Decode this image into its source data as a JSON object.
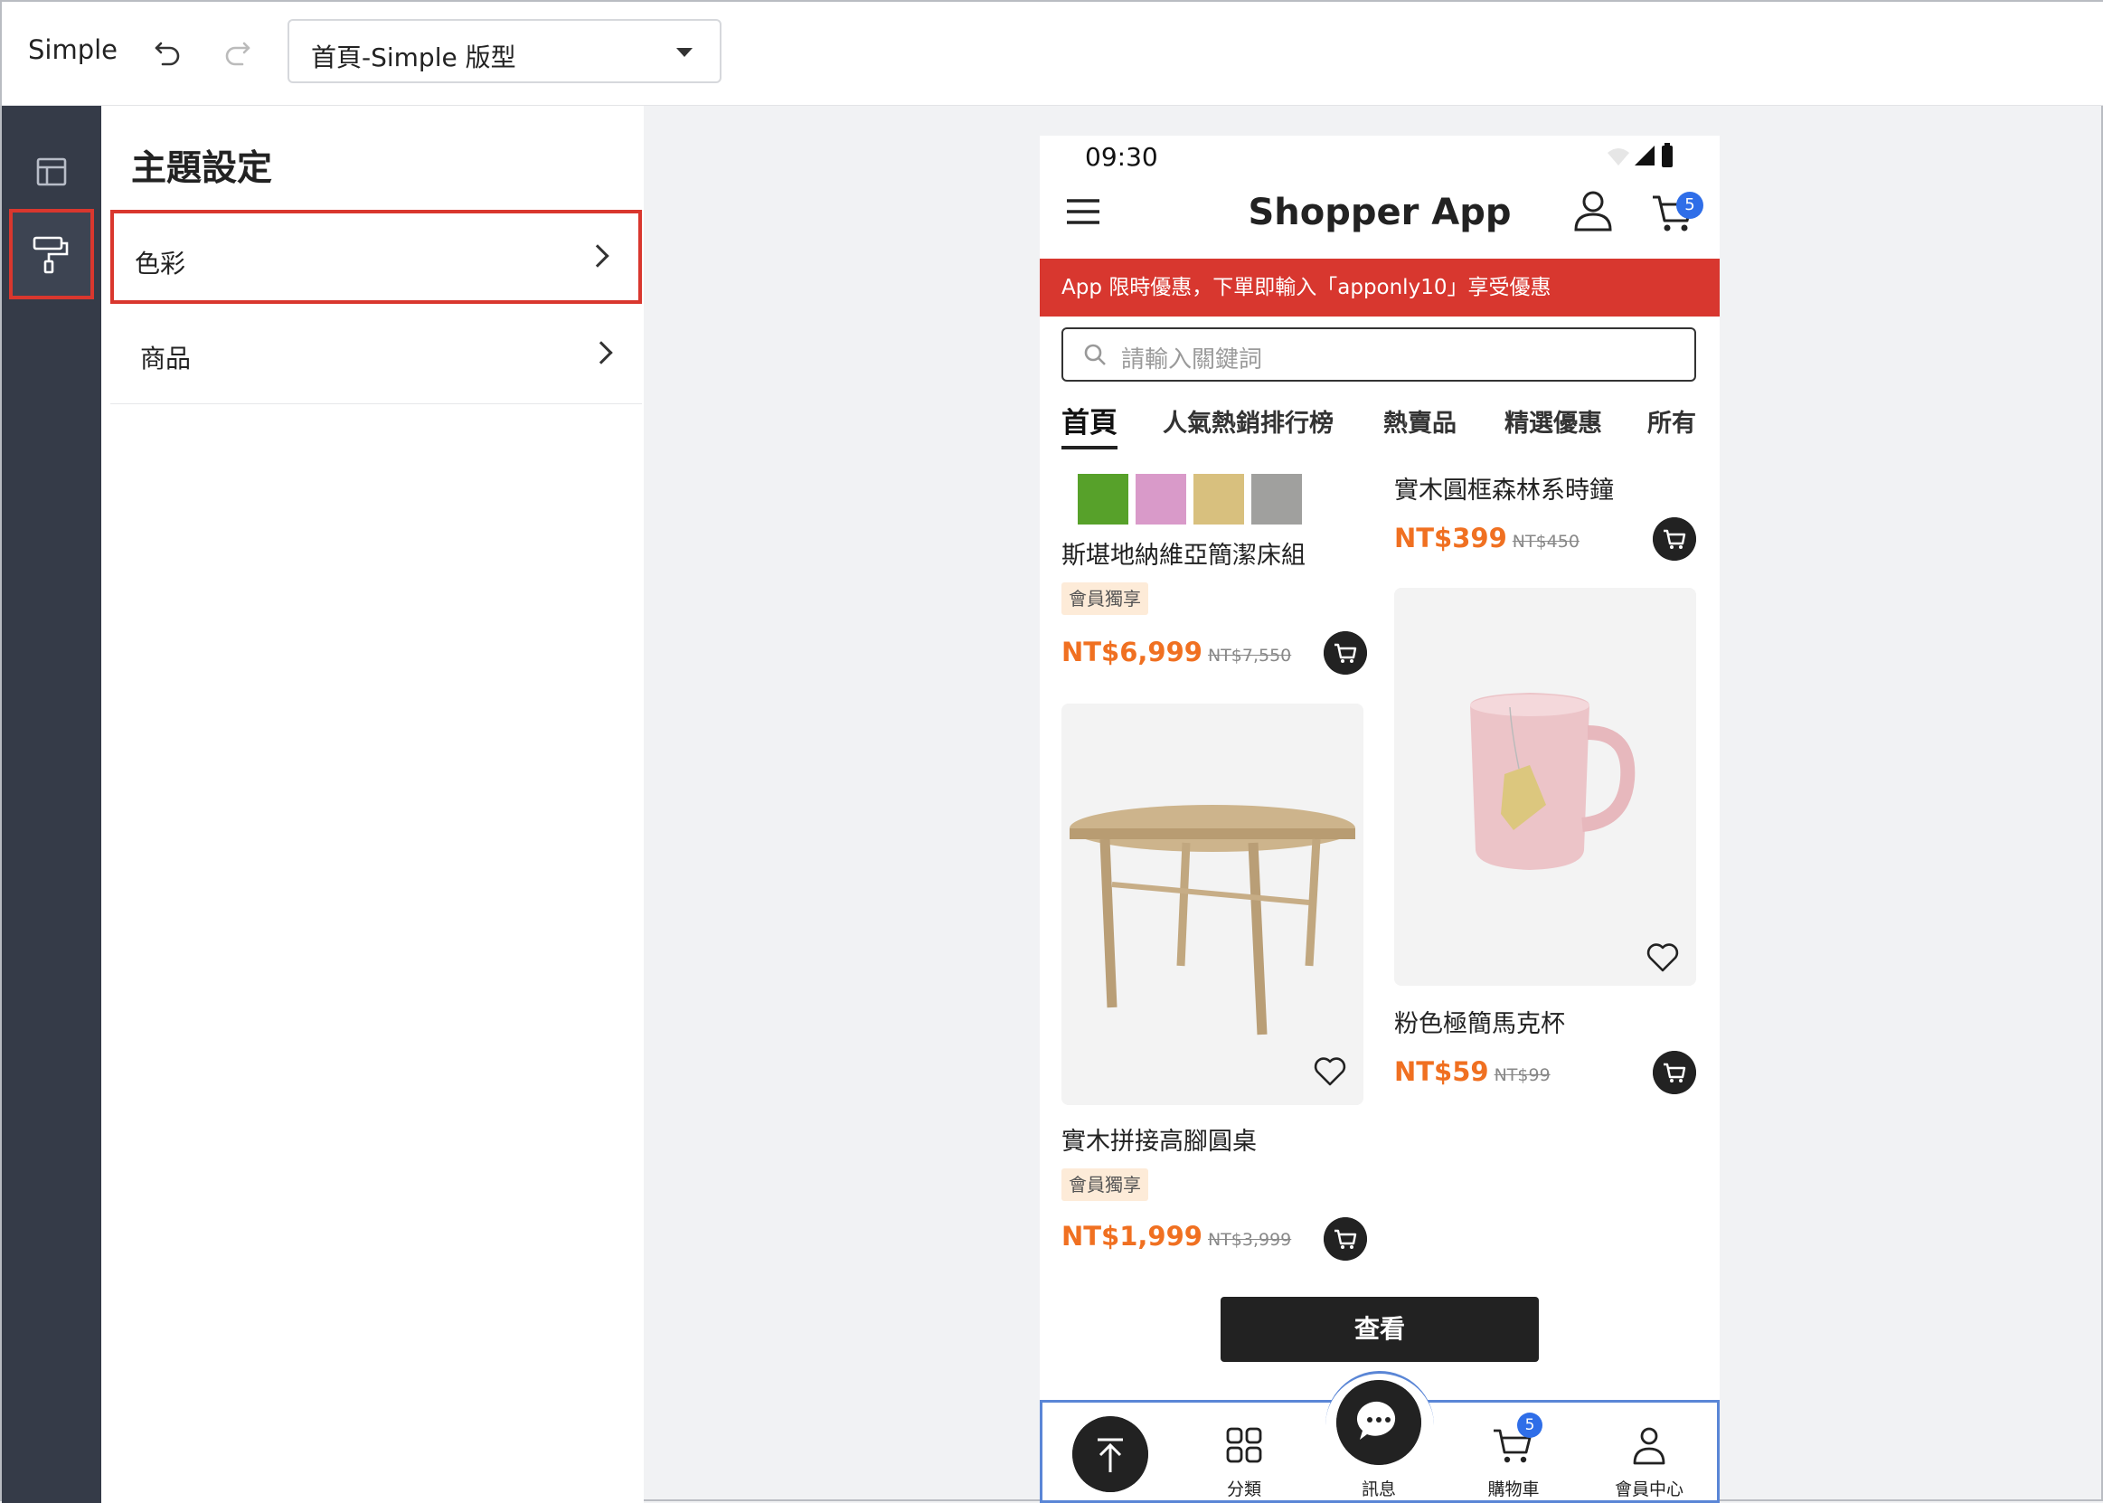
{
  "editor": {
    "app_name": "Simple",
    "page_selector": {
      "value": "首頁-Simple 版型"
    }
  },
  "panel": {
    "title": "主題設定",
    "items": [
      {
        "label": "色彩"
      },
      {
        "label": "商品"
      }
    ]
  },
  "preview": {
    "status_time": "09:30",
    "app_title": "Shopper App",
    "cart_count": "5",
    "promo": "App 限時優惠，下單即輸入「apponly10」享受優惠",
    "search_placeholder": "請輸入關鍵詞",
    "tabs": [
      "首頁",
      "人氣熱銷排行榜",
      "熱賣品",
      "精選優惠",
      "所有"
    ],
    "swatch_colors": [
      "#57a12a",
      "#d99ac9",
      "#d8c07e",
      "#a0a09e"
    ],
    "products": [
      {
        "name": "斯堪地納維亞簡潔床組",
        "tag": "會員獨享",
        "price": "NT$6,999",
        "original_price": "NT$7,550"
      },
      {
        "name": "實木圓框森林系時鐘",
        "price": "NT$399",
        "original_price": "NT$450"
      },
      {
        "name": "實木拼接高腳圓桌",
        "tag": "會員獨享",
        "price": "NT$1,999",
        "original_price": "NT$3,999"
      },
      {
        "name": "粉色極簡馬克杯",
        "price": "NT$59",
        "original_price": "NT$99"
      }
    ],
    "view_button": "查看",
    "bottom_nav": [
      {
        "label": "分類"
      },
      {
        "label": "訊息"
      },
      {
        "label": "購物車"
      },
      {
        "label": "會員中心"
      }
    ],
    "nav_cart_count": "5"
  }
}
